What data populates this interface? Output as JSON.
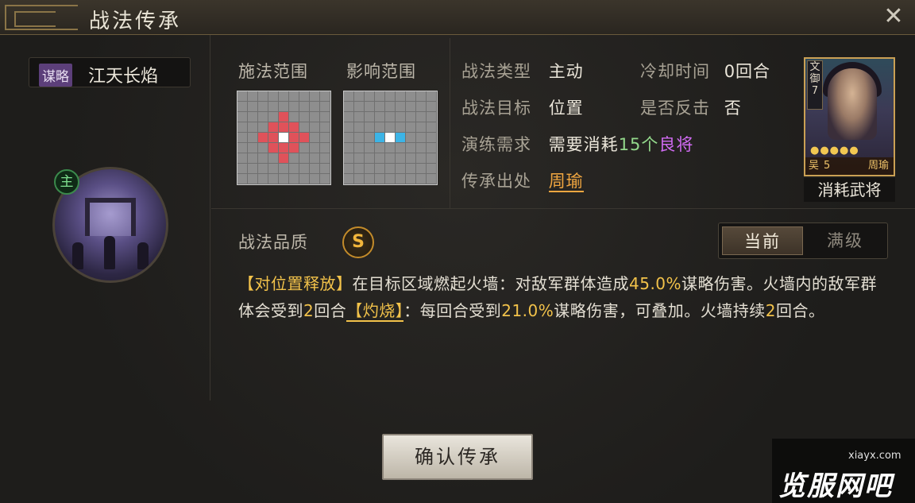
{
  "header": {
    "title": "战法传承"
  },
  "skill": {
    "tag": "谋略",
    "name": "江天长焰",
    "badge": "主",
    "range_labels": [
      "施法范围",
      "影响范围"
    ],
    "cast_grid": {
      "size": 9,
      "colors": {
        "red": "#e0525a",
        "white": "#ffffff",
        "blue": "#3cb4e6"
      },
      "cells": [
        {
          "r": 2,
          "c": 4,
          "t": "red"
        },
        {
          "r": 3,
          "c": 3,
          "t": "red"
        },
        {
          "r": 3,
          "c": 4,
          "t": "red"
        },
        {
          "r": 3,
          "c": 5,
          "t": "red"
        },
        {
          "r": 4,
          "c": 2,
          "t": "red"
        },
        {
          "r": 4,
          "c": 3,
          "t": "red"
        },
        {
          "r": 4,
          "c": 4,
          "t": "white"
        },
        {
          "r": 4,
          "c": 5,
          "t": "red"
        },
        {
          "r": 4,
          "c": 6,
          "t": "red"
        },
        {
          "r": 5,
          "c": 3,
          "t": "red"
        },
        {
          "r": 5,
          "c": 4,
          "t": "red"
        },
        {
          "r": 5,
          "c": 5,
          "t": "red"
        },
        {
          "r": 6,
          "c": 4,
          "t": "red"
        }
      ]
    },
    "effect_grid": {
      "size": 9,
      "cells": [
        {
          "r": 4,
          "c": 3,
          "t": "blue"
        },
        {
          "r": 4,
          "c": 4,
          "t": "white"
        },
        {
          "r": 4,
          "c": 5,
          "t": "blue"
        }
      ]
    }
  },
  "info": {
    "type_label": "战法类型",
    "type_value": "主动",
    "cooldown_label": "冷却时间",
    "cooldown_value": "0回合",
    "target_label": "战法目标",
    "target_value": "位置",
    "counter_label": "是否反击",
    "counter_value": "否",
    "require_label": "演练需求",
    "require_prefix": "需要消耗",
    "require_count": "15个",
    "require_item": "良将",
    "origin_label": "传承出处",
    "origin_value": "周瑜"
  },
  "general_card": {
    "camp": "文",
    "role": "御",
    "level": "7",
    "stars": "●●●●●",
    "faction": "吴",
    "cost": "5",
    "name": "周瑜",
    "caption": "消耗武将"
  },
  "quality": {
    "label": "战法品质",
    "grade": "S"
  },
  "toggle": {
    "current": "当前",
    "max": "满级"
  },
  "description": {
    "tag1": "【对位置释放】",
    "p1": "在目标区域燃起火墙：对敌军群体造成",
    "v1": "45.0%",
    "p2": "谋略伤害。火墙内的敌军群体会受到",
    "v2": "2",
    "p3": "回合",
    "tag2": "【灼烧】",
    "p4": "：每回合受到",
    "v3": "21.0%",
    "p5": "谋略伤害，可叠加。火墙持续",
    "v4": "2",
    "p6": "回合。"
  },
  "confirm_label": "确认传承",
  "watermark": {
    "url": "xiayx.com",
    "text": "览服网吧"
  }
}
